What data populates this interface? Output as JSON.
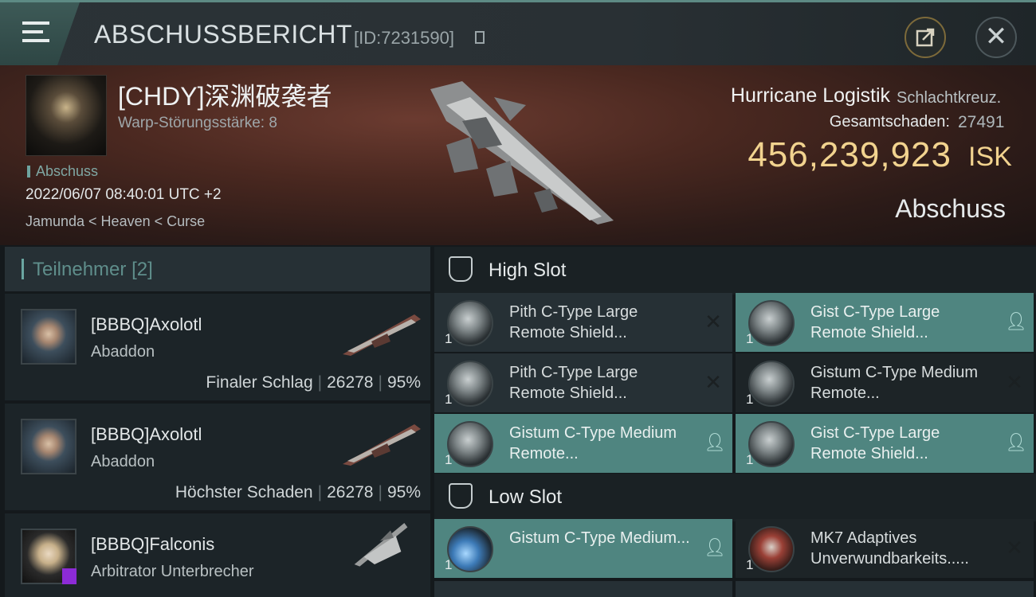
{
  "header": {
    "title": "ABSCHUSSBERICHT",
    "kill_id": "[ID:7231590]"
  },
  "victim": {
    "name": "[CHDY]深渊破袭者",
    "warp_strength": "Warp-Störungsstärke: 8",
    "kill_tag": "Abschuss",
    "timestamp": "2022/06/07 08:40:01 UTC +2",
    "location": "Jamunda < Heaven < Curse",
    "ship_name": "Hurricane Logistik",
    "ship_class": "Schlachtkreuz.",
    "total_damage_label": "Gesamtschaden:",
    "total_damage": "27491",
    "isk_value": "456,239,923",
    "isk_unit": "ISK",
    "kill_type": "Abschuss"
  },
  "participants": {
    "label": "Teilnehmer",
    "count": "[2]",
    "rows": [
      {
        "name": "[BBBQ]Axolotl",
        "ship": "Abaddon",
        "role": "Finaler Schlag",
        "damage": "26278",
        "percent": "95%"
      },
      {
        "name": "[BBBQ]Axolotl",
        "ship": "Abaddon",
        "role": "Höchster Schaden",
        "damage": "26278",
        "percent": "95%"
      },
      {
        "name": "[BBBQ]Falconis",
        "ship": "Arbitrator Unterbrecher",
        "role": "",
        "damage": "",
        "percent": ""
      }
    ]
  },
  "high_slot": {
    "label": "High Slot",
    "modules": [
      {
        "qty": "1",
        "name": "Pith C-Type Large Remote Shield...",
        "state": "destroyed"
      },
      {
        "qty": "1",
        "name": "Gist C-Type Large Remote Shield...",
        "state": "dropped"
      },
      {
        "qty": "1",
        "name": "Pith C-Type Large Remote Shield...",
        "state": "destroyed"
      },
      {
        "qty": "1",
        "name": "Gistum C-Type Medium Remote...",
        "state": "destroyed"
      },
      {
        "qty": "1",
        "name": "Gistum C-Type Medium Remote...",
        "state": "dropped"
      },
      {
        "qty": "1",
        "name": "Gist C-Type Large Remote Shield...",
        "state": "dropped"
      }
    ]
  },
  "low_slot": {
    "label": "Low Slot",
    "modules": [
      {
        "qty": "1",
        "name": "Gistum C-Type Medium...",
        "state": "dropped"
      },
      {
        "qty": "1",
        "name": "MK7 Adaptives Unverwundbarkeits.....",
        "state": "destroyed"
      }
    ]
  },
  "icons": {
    "menu": "hamburger-icon",
    "copy": "copy-icon",
    "share": "share-icon",
    "close": "close-icon",
    "destroyed": "x-icon",
    "dropped": "person-icon",
    "slot": "slot-icon"
  },
  "colors": {
    "accent": "#5d8a84",
    "isk": "#f2d38f",
    "dropped_bg": "#4f8580",
    "destroyed_bg": "#263035",
    "badge": "#8c2bd6"
  }
}
